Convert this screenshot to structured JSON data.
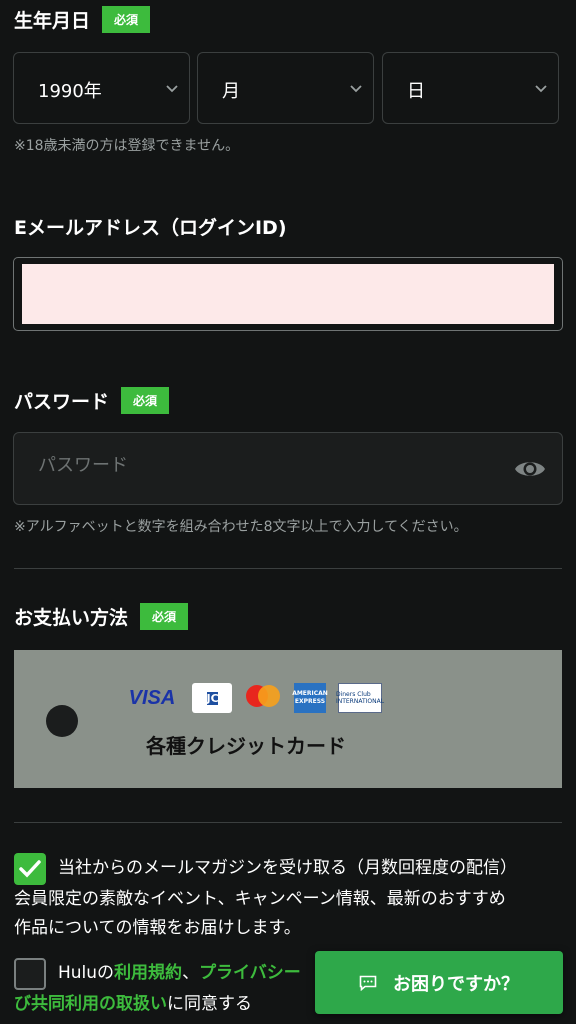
{
  "birthdate": {
    "label": "生年月日",
    "badge": "必須",
    "year": "1990年",
    "month": "月",
    "day": "日",
    "note": "※18歳未満の方は登録できません。"
  },
  "email": {
    "label": "Eメールアドレス（ログインID)",
    "value": ""
  },
  "password": {
    "label": "パスワード",
    "badge": "必須",
    "placeholder": "パスワード",
    "note": "※アルファベットと数字を組み合わせた8文字以上で入力してください。"
  },
  "payment": {
    "label": "お支払い方法",
    "badge": "必須",
    "option_title": "各種クレジットカード",
    "logos": [
      "VISA",
      "JCB",
      "mastercard",
      "AMERICAN EXPRESS",
      "Diners Club INTERNATIONAL"
    ]
  },
  "newsletter": {
    "line1": "当社からのメールマガジンを受け取る（月数回程度の配信）",
    "line2": "会員限定の素敵なイベント、キャンペーン情報、最新のおすすめ",
    "line3": "作品についての情報をお届けします。",
    "checked": true
  },
  "terms": {
    "prefix": "Huluの",
    "link1": "利用規約",
    "sep": "、",
    "link2": "プライバシー",
    "link3": "び共同利用の取扱い",
    "suffix": "に同意する",
    "checked": false
  },
  "help": {
    "label": "お困りですか？"
  },
  "colors": {
    "accent": "#3dbb3d",
    "background": "#121414"
  }
}
